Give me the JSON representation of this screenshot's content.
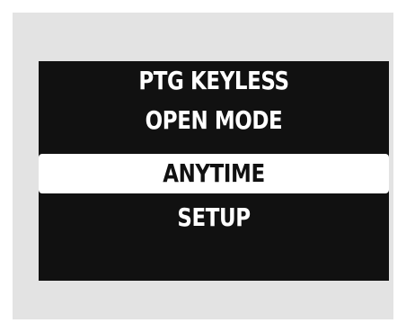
{
  "menu": {
    "title_line1": "PTG KEYLESS",
    "title_line2": "OPEN MODE",
    "selected_option": "ANYTIME",
    "next_option": "SETUP"
  },
  "colors": {
    "panel_background": "#e3e3e3",
    "screen_background": "#111111",
    "text": "#ffffff",
    "highlight": "#ffffff"
  }
}
